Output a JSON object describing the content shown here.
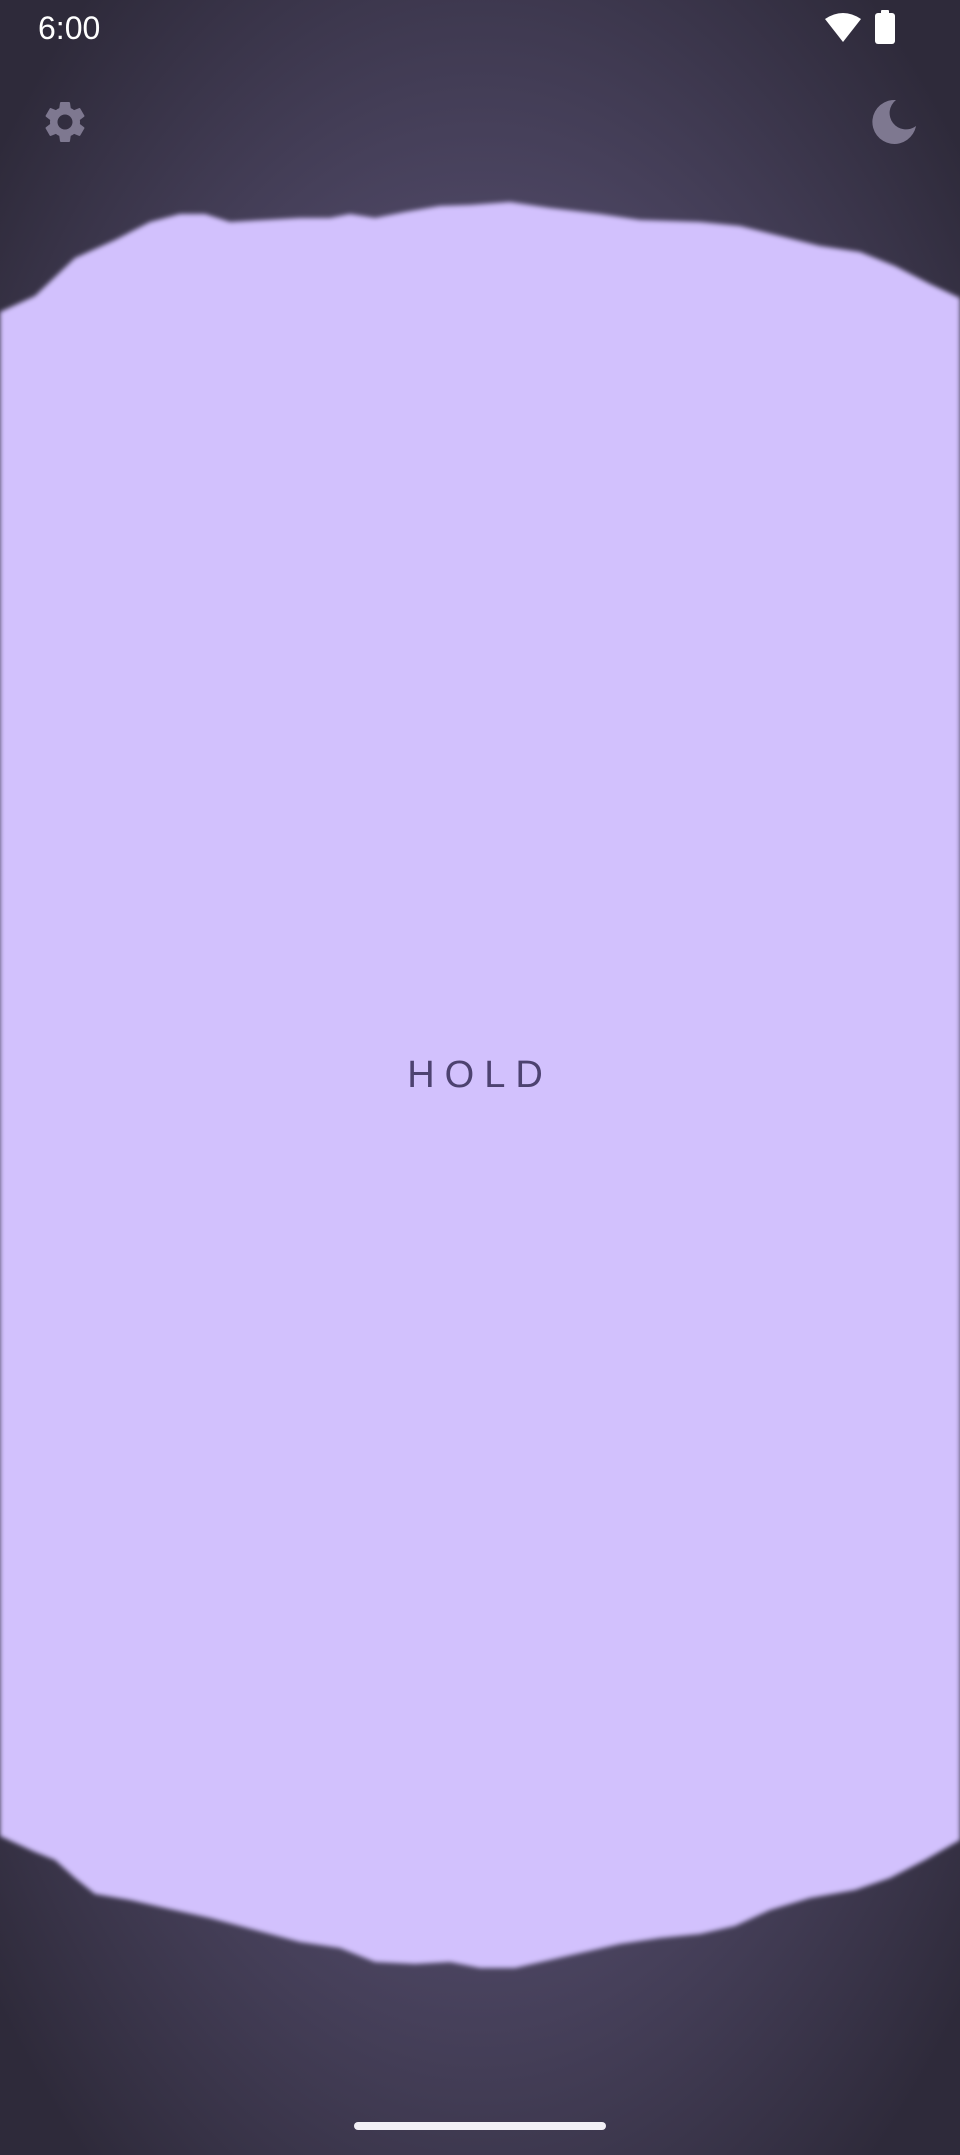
{
  "status_bar": {
    "time": "6:00",
    "wifi_icon": "wifi-icon",
    "battery_icon": "battery-icon"
  },
  "toolbar": {
    "settings_icon": "gear-icon",
    "theme_icon": "moon-icon"
  },
  "main": {
    "hold_label": "HOLD"
  },
  "colors": {
    "blob": "#d2c1fd",
    "hold_text": "#4d4270",
    "icon_gray": "#7e7890",
    "background_dark": "#2e2a3a"
  }
}
